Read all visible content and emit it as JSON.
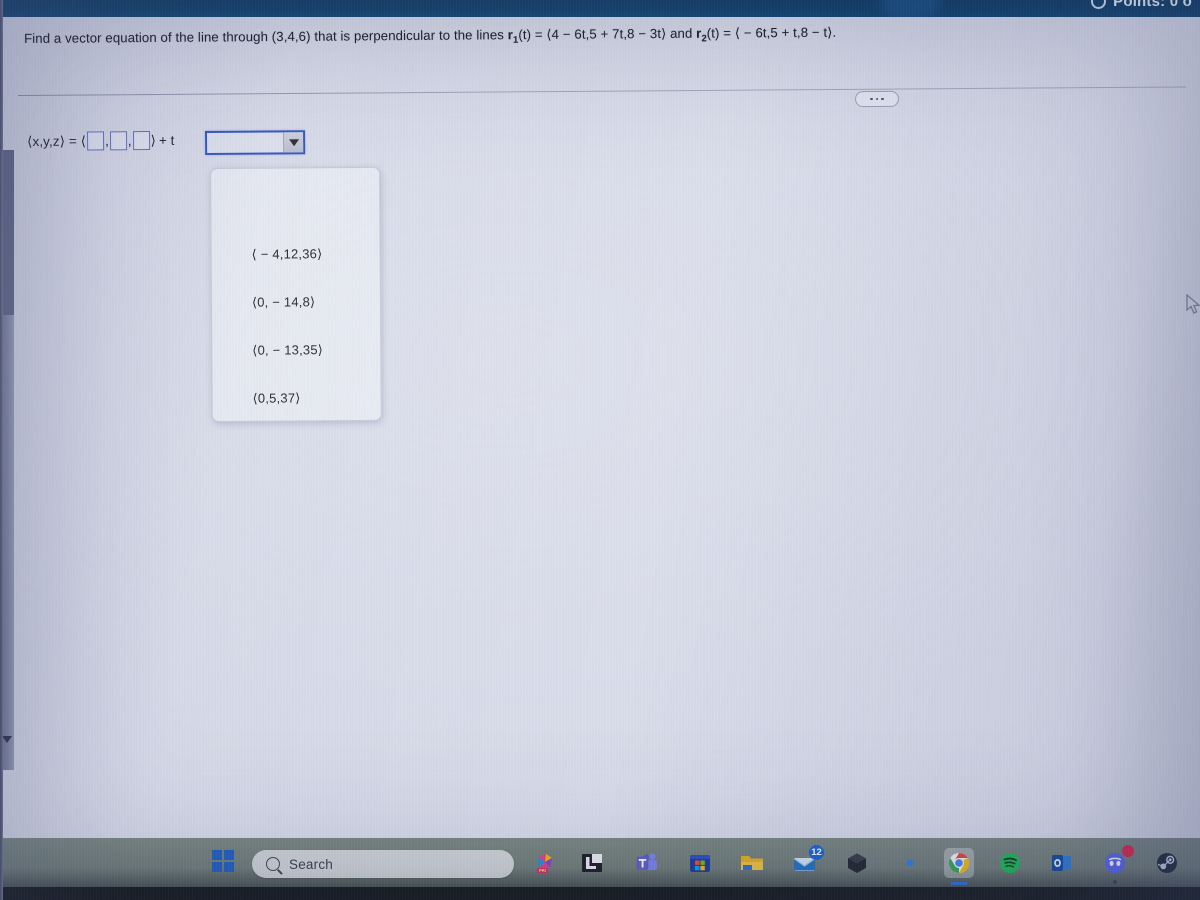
{
  "header": {
    "points_label": "Points: 0 o",
    "status_icon": "progress-circle-icon",
    "bar_color": "#0c3d68"
  },
  "question": {
    "prefix": "Find a vector equation of the line through (3,4,6) that is perpendicular to the lines ",
    "r1_name": "r",
    "r1_sub": "1",
    "r1_body": "(t) = ⟨4 − 6t,5 + 7t,8 − 3t⟩",
    "conjunction": " and ",
    "r2_name": "r",
    "r2_sub": "2",
    "r2_body": "(t) = ⟨ − 6t,5 + t,8 − t⟩.",
    "more_button_label": "•••"
  },
  "answer": {
    "lhs": "⟨x,y,z⟩ = ⟨",
    "comma": ",",
    "close_bracket": "⟩",
    "plus_t": "+ t",
    "box_values": [
      "",
      "",
      ""
    ],
    "border_color": "#5b6cc4"
  },
  "combobox": {
    "value": "",
    "placeholder": "",
    "arrow_icon": "chevron-down-icon",
    "focus_color": "#2b4ec2",
    "expanded": true
  },
  "dropdown": {
    "options": [
      "⟨ − 4,12,36⟩",
      "⟨0, − 14,8⟩",
      "⟨0, − 13,35⟩",
      "⟨0,5,37⟩"
    ],
    "selected_index": -1
  },
  "scrollbar": {
    "arrow_icon": "chevron-down-icon",
    "orientation": "vertical"
  },
  "cursor": {
    "icon": "mouse-pointer-icon"
  },
  "taskbar": {
    "start_label": "Start",
    "start_icon": "windows-logo-icon",
    "search": {
      "icon": "search-icon",
      "placeholder": "Search",
      "value": ""
    },
    "items": [
      {
        "name": "copilot-365-icon",
        "label": "Microsoft 365 Copilot",
        "badge": "",
        "active": false
      },
      {
        "name": "app-l-icon",
        "label": "L",
        "badge": "",
        "active": false
      },
      {
        "name": "teams-icon",
        "label": "Microsoft Teams",
        "badge": "",
        "active": false
      },
      {
        "name": "microsoft-store-icon",
        "label": "Microsoft Store",
        "badge": "",
        "active": false
      },
      {
        "name": "file-explorer-icon",
        "label": "File Explorer",
        "badge": "",
        "active": false
      },
      {
        "name": "mail-icon",
        "label": "Mail",
        "badge": "12",
        "active": false
      },
      {
        "name": "hexagon-app-icon",
        "label": "App",
        "badge": "",
        "active": false
      },
      {
        "name": "copilot-icon",
        "label": "Copilot",
        "badge": "",
        "active": false
      },
      {
        "name": "chrome-icon",
        "label": "Google Chrome",
        "badge": "",
        "active": true
      },
      {
        "name": "spotify-icon",
        "label": "Spotify",
        "badge": "",
        "active": false
      },
      {
        "name": "outlook-icon",
        "label": "Outlook",
        "badge": "",
        "active": false
      },
      {
        "name": "discord-icon",
        "label": "Discord",
        "badge": "•",
        "active": false
      },
      {
        "name": "steam-icon",
        "label": "Steam",
        "badge": "",
        "active": false
      }
    ]
  }
}
